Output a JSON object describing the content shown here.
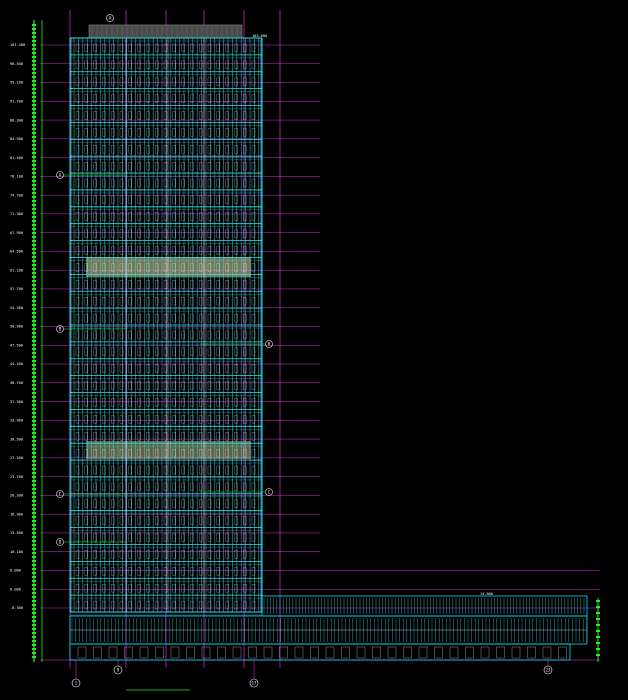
{
  "drawing": {
    "background": "#000000",
    "colors": {
      "facade": "#33e0e8",
      "frame": "#00e0ff",
      "grid": "#ff33ff",
      "dimension": "#22ee22",
      "crown": "#4a4a4a",
      "panel": "#d9d79a",
      "text": "#ffffff"
    },
    "level_marks": [
      "101.400",
      "98.500",
      "95.100",
      "91.700",
      "88.300",
      "84.900",
      "81.500",
      "78.100",
      "74.700",
      "71.300",
      "67.900",
      "64.500",
      "61.100",
      "57.700",
      "54.300",
      "50.900",
      "47.500",
      "44.100",
      "40.700",
      "37.300",
      "33.900",
      "30.500",
      "27.100",
      "23.700",
      "20.300",
      "16.900",
      "13.500",
      "10.100",
      "6.000",
      "0.000",
      "-0.300"
    ],
    "roof_mark": "103.600",
    "podium_mark": "14.000",
    "section_tags": [
      "A",
      "B",
      "C",
      "D",
      "E"
    ],
    "axis_tags": [
      "1",
      "9",
      "17",
      "23"
    ],
    "crown_tag": "A"
  }
}
